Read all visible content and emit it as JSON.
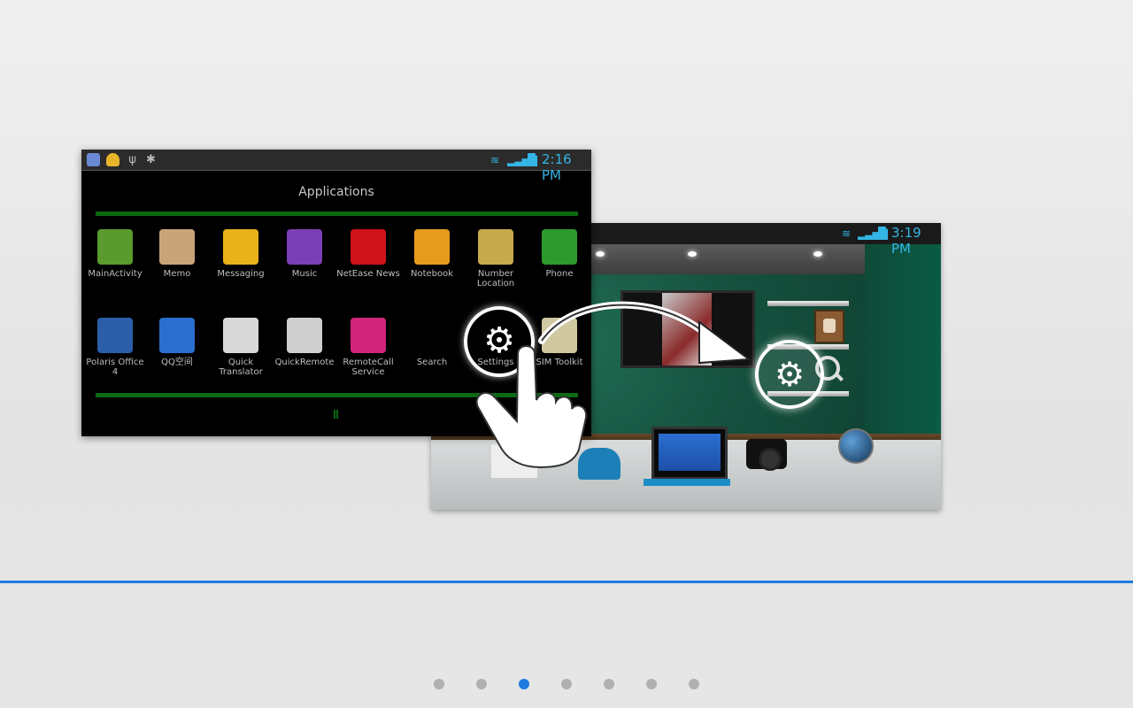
{
  "front_screen": {
    "status_time": "2:16 PM",
    "title": "Applications",
    "apps": [
      {
        "label": "MainActivity",
        "icon": "android-icon",
        "color": "#5a9a2e"
      },
      {
        "label": "Memo",
        "icon": "memo-icon",
        "color": "#c9a37a"
      },
      {
        "label": "Messaging",
        "icon": "messaging-icon",
        "color": "#e9b21a"
      },
      {
        "label": "Music",
        "icon": "music-icon",
        "color": "#7b3fb5"
      },
      {
        "label": "NetEase News",
        "icon": "netease-news-icon",
        "color": "#d0121a"
      },
      {
        "label": "Notebook",
        "icon": "notebook-icon",
        "color": "#e69b1e"
      },
      {
        "label": "Number Location",
        "icon": "number-location-icon",
        "color": "#c7a94e"
      },
      {
        "label": "Phone",
        "icon": "phone-icon",
        "color": "#2e9a2e"
      },
      {
        "label": "Polaris Office 4",
        "icon": "polaris-office-icon",
        "color": "#2a5ea8"
      },
      {
        "label": "QQ空间",
        "icon": "qq-space-icon",
        "color": "#2a6fd0"
      },
      {
        "label": "Quick Translator",
        "icon": "quick-translator-icon",
        "color": "#d8d8d8"
      },
      {
        "label": "QuickRemote",
        "icon": "quick-remote-icon",
        "color": "#cfcfcf"
      },
      {
        "label": "RemoteCall Service",
        "icon": "remote-call-icon",
        "color": "#d0257a"
      },
      {
        "label": "Search",
        "icon": "search-icon",
        "color": "#000000"
      },
      {
        "label": "Settings",
        "icon": "settings-icon",
        "color": "#000000"
      },
      {
        "label": "SIM Toolkit",
        "icon": "sim-toolkit-icon",
        "color": "#cfc8a0"
      }
    ]
  },
  "back_screen": {
    "status_time": "3:19 PM"
  },
  "pagination": {
    "count": 7,
    "active_index": 2
  },
  "colors": {
    "accent": "#1e7be0",
    "status_blue": "#33b5e5",
    "green_bar": "#0c6a12"
  }
}
